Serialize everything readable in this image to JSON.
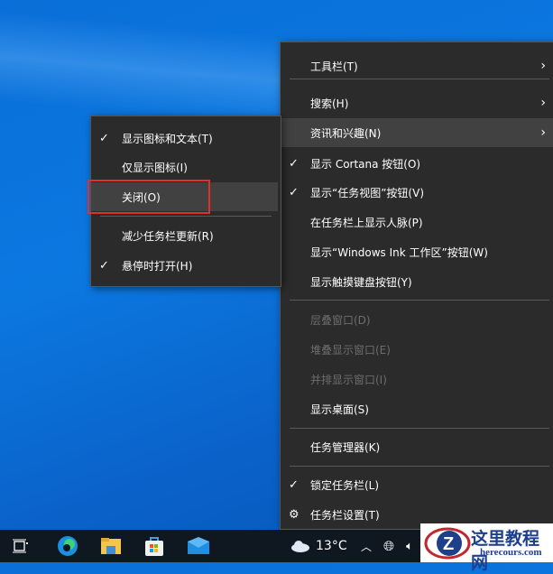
{
  "main_menu": {
    "items": [
      {
        "label": "工具栏(T)",
        "arrow": true
      },
      {
        "label": "搜索(H)",
        "arrow": true
      },
      {
        "label": "资讯和兴趣(N)",
        "arrow": true,
        "highlighted": true
      },
      {
        "label": "显示 Cortana 按钮(O)",
        "checked": true
      },
      {
        "label": "显示“任务视图”按钮(V)",
        "checked": true
      },
      {
        "label": "在任务栏上显示人脉(P)"
      },
      {
        "label": "显示“Windows Ink 工作区”按钮(W)"
      },
      {
        "label": "显示触摸键盘按钮(Y)"
      },
      {
        "label": "层叠窗口(D)",
        "disabled": true
      },
      {
        "label": "堆叠显示窗口(E)",
        "disabled": true
      },
      {
        "label": "并排显示窗口(I)",
        "disabled": true
      },
      {
        "label": "显示桌面(S)"
      },
      {
        "label": "任务管理器(K)"
      },
      {
        "label": "锁定任务栏(L)",
        "checked": true
      },
      {
        "label": "任务栏设置(T)",
        "icon": "gear-icon"
      }
    ]
  },
  "sub_menu": {
    "items": [
      {
        "label": "显示图标和文本(T)",
        "checked": true
      },
      {
        "label": "仅显示图标(I)"
      },
      {
        "label": "关闭(O)",
        "highlighted": true
      },
      {
        "label": "减少任务栏更新(R)"
      },
      {
        "label": "悬停时打开(H)",
        "checked": true
      }
    ]
  },
  "taskbar": {
    "temperature": "13°C"
  },
  "watermark": {
    "title": "这里教程网",
    "url": "herecours.com"
  }
}
